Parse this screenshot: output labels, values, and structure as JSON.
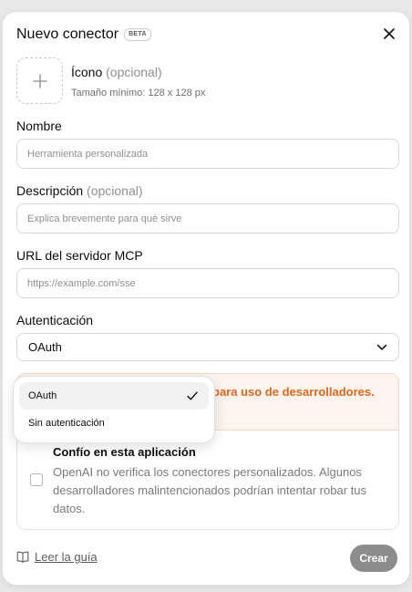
{
  "dialog": {
    "title": "Nuevo conector",
    "badge": "BETA",
    "close_icon": "close-icon"
  },
  "icon_field": {
    "label": "Ícono",
    "optional": "(opcional)",
    "hint": "Tamaño mínimo: 128 x 128 px",
    "icon": "plus-icon"
  },
  "name_field": {
    "label": "Nombre",
    "placeholder": "Herramienta personalizada",
    "value": ""
  },
  "description_field": {
    "label": "Descripción",
    "optional": "(opcional)",
    "placeholder": "Explica brevemente para qué sirve",
    "value": ""
  },
  "url_field": {
    "label": "URL del servidor MCP",
    "placeholder": "https://example.com/sse",
    "value": ""
  },
  "auth_field": {
    "label": "Autenticación",
    "selected": "OAuth",
    "icon": "chevron-down-icon",
    "options": [
      {
        "label": "OAuth",
        "selected": true
      },
      {
        "label": "Sin autenticación",
        "selected": false
      }
    ]
  },
  "warning": {
    "text": "para uso de desarrolladores."
  },
  "trust": {
    "title": "Confío en esta aplicación",
    "body": "OpenAI no verifica los conectores personalizados. Algunos desarrolladores malintencionados podrían intentar robar tus datos.",
    "checked": false
  },
  "footer": {
    "guide_label": "Leer la guía",
    "guide_icon": "book-icon",
    "create_label": "Crear"
  },
  "colors": {
    "warning_text": "#e0661d",
    "warning_bg": "#fdf4ee",
    "create_button_bg": "#8c8c8c"
  }
}
